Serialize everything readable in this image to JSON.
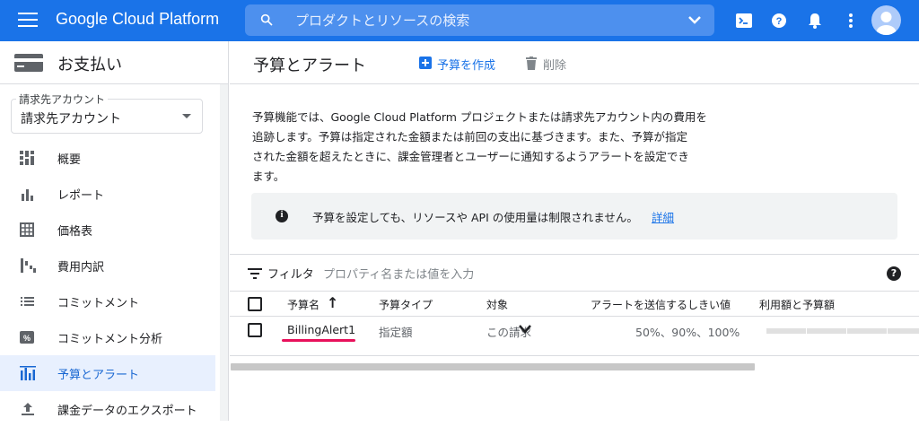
{
  "topbar": {
    "brand": "Google Cloud Platform",
    "search_placeholder": "プロダクトとリソースの検索",
    "icons": [
      "menu-icon",
      "search-icon",
      "chevron-down-icon",
      "cloud-shell-icon",
      "help-icon",
      "bell-icon",
      "more-vert-icon",
      "account-avatar"
    ]
  },
  "sidebar": {
    "title": "お支払い",
    "account_label": "請求先アカウント",
    "account_value": "請求先アカウント",
    "items": [
      {
        "label": "概要",
        "icon": "dashboard-icon"
      },
      {
        "label": "レポート",
        "icon": "bar-chart-icon"
      },
      {
        "label": "価格表",
        "icon": "table-icon"
      },
      {
        "label": "費用内訳",
        "icon": "waterfall-icon"
      },
      {
        "label": "コミットメント",
        "icon": "list-icon"
      },
      {
        "label": "コミットメント分析",
        "icon": "percent-icon"
      },
      {
        "label": "予算とアラート",
        "icon": "budget-icon",
        "active": true
      },
      {
        "label": "課金データのエクスポート",
        "icon": "upload-icon"
      }
    ]
  },
  "main": {
    "title": "予算とアラート",
    "create_label": "予算を作成",
    "delete_label": "削除",
    "intro_lines": [
      "予算機能では、Google Cloud Platform プロジェクトまたは請求先アカウント内の費用を",
      "追跡します。予算は指定された金額または前回の支出に基づきます。また、予算が指定",
      "された金額を超えたときに、課金管理者とユーザーに通知するようアラートを設定でき",
      "ます。"
    ],
    "note_text": "予算を設定しても、リソースや API の使用量は制限されません。",
    "note_link": "詳細",
    "filter_label": "フィルタ",
    "filter_placeholder": "プロパティ名または値を入力",
    "help": "?"
  },
  "table": {
    "headers": [
      "予算名",
      "予算タイプ",
      "対象",
      "アラートを送信するしきい値",
      "利用額と予算額"
    ],
    "sort_indicator": "↑",
    "rows": [
      {
        "name": "BillingAlert1",
        "type": "指定額",
        "scope": "この請求",
        "thresholds": "50%、90%、100%"
      }
    ]
  },
  "colors": {
    "topbar": "#1a73e8",
    "accent": "#1a73e8",
    "highlight_underline": "#e8115b",
    "active_nav_bg": "#e8f0fe"
  }
}
